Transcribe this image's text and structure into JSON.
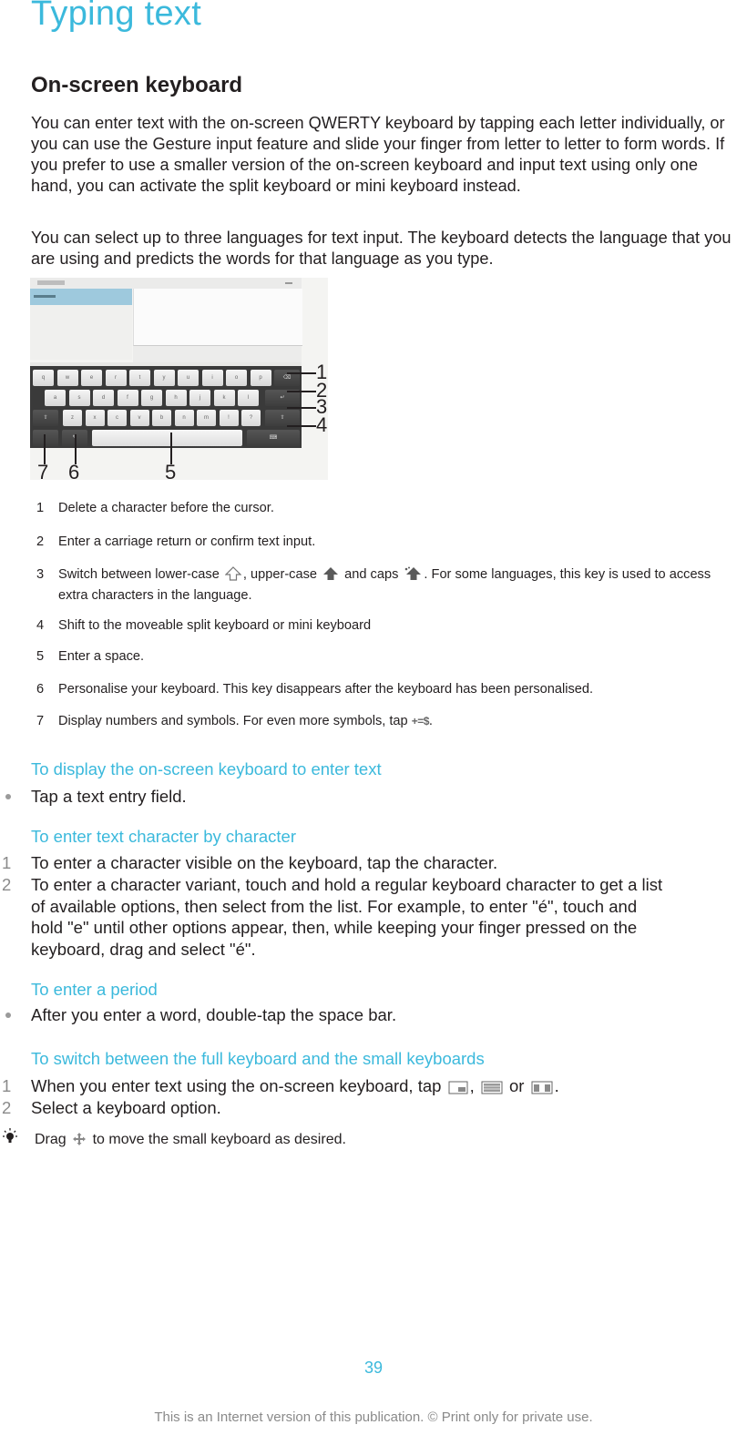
{
  "page": {
    "title": "Typing text",
    "section_heading": "On-screen keyboard",
    "intro_paragraphs": [
      "You can enter text with the on-screen QWERTY keyboard by tapping each letter individually, or you can use the Gesture input feature and slide your finger from letter to letter to form words. If you prefer to use a smaller version of the on-screen keyboard and input text using only one hand, you can activate the split keyboard or mini keyboard instead.",
      "You can select up to three languages for text input. The keyboard detects the language that you are using and predicts the words for that language as you type."
    ]
  },
  "illustration": {
    "description": "Tablet on-screen keyboard with numbered callouts",
    "rows": [
      [
        "q",
        "w",
        "e",
        "r",
        "t",
        "y",
        "u",
        "i",
        "o",
        "p"
      ],
      [
        "a",
        "s",
        "d",
        "f",
        "g",
        "h",
        "j",
        "k",
        "l"
      ],
      [
        "z",
        "x",
        "c",
        "v",
        "b",
        "n",
        "m",
        "!",
        "?"
      ]
    ],
    "callouts": [
      "1",
      "2",
      "3",
      "4",
      "5",
      "6",
      "7"
    ],
    "icons": {
      "delete": "backspace-icon",
      "enter": "return-icon",
      "shift": "shift-icon",
      "keyboard_switch": "keyboard-icon",
      "settings": "pen-icon",
      "symbols": "symbols-icon"
    }
  },
  "legend": [
    {
      "num": "1",
      "text": "Delete a character before the cursor."
    },
    {
      "num": "2",
      "text": "Enter a carriage return or confirm text input."
    },
    {
      "num": "3",
      "text_parts": [
        "Switch between lower-case ",
        ", upper-case ",
        " and caps ",
        ". For some languages, this key is used to access extra characters in the language."
      ],
      "icons": [
        "shift-outline-icon",
        "shift-filled-icon",
        "caps-lock-icon"
      ]
    },
    {
      "num": "4",
      "text": "Shift to the moveable split keyboard or mini keyboard"
    },
    {
      "num": "5",
      "text": "Enter a space."
    },
    {
      "num": "6",
      "text": "Personalise your keyboard. This key disappears after the keyboard has been personalised."
    },
    {
      "num": "7",
      "text_parts": [
        "Display numbers and symbols. For even more symbols, tap ",
        "."
      ],
      "symbol_key": "+=$"
    }
  ],
  "sections": [
    {
      "heading": "To display the on-screen keyboard to enter text",
      "bullets": [
        "Tap a text entry field."
      ]
    },
    {
      "heading": "To enter text character by character",
      "steps": [
        {
          "num": "1",
          "text": "To enter a character visible on the keyboard, tap the character."
        },
        {
          "num": "2",
          "text": "To enter a character variant, touch and hold a regular keyboard character to get a list of available options, then select from the list. For example, to enter \"é\", touch and hold \"e\" until other options appear, then, while keeping your finger pressed on the keyboard, drag and select \"é\"."
        }
      ]
    },
    {
      "heading": "To enter a period",
      "bullets": [
        "After you enter a word, double-tap the space bar."
      ]
    },
    {
      "heading": "To switch between the full keyboard and the small keyboards",
      "steps": [
        {
          "num": "1",
          "text_parts": [
            "When you enter text using the on-screen keyboard, tap ",
            ", ",
            " or ",
            "."
          ],
          "icons": [
            "mini-keyboard-icon",
            "full-keyboard-icon",
            "split-keyboard-icon"
          ]
        },
        {
          "num": "2",
          "text": "Select a keyboard option."
        }
      ]
    }
  ],
  "tip": {
    "icon": "lightbulb-icon",
    "text_parts": [
      "Drag ",
      " to move the small keyboard as desired."
    ],
    "inline_icon": "move-icon"
  },
  "footer": {
    "page_number": "39",
    "notice": "This is an Internet version of this publication. © Print only for private use."
  },
  "colors": {
    "accent": "#3bb9dc",
    "text": "#231f20",
    "muted": "#8a8a8a"
  }
}
